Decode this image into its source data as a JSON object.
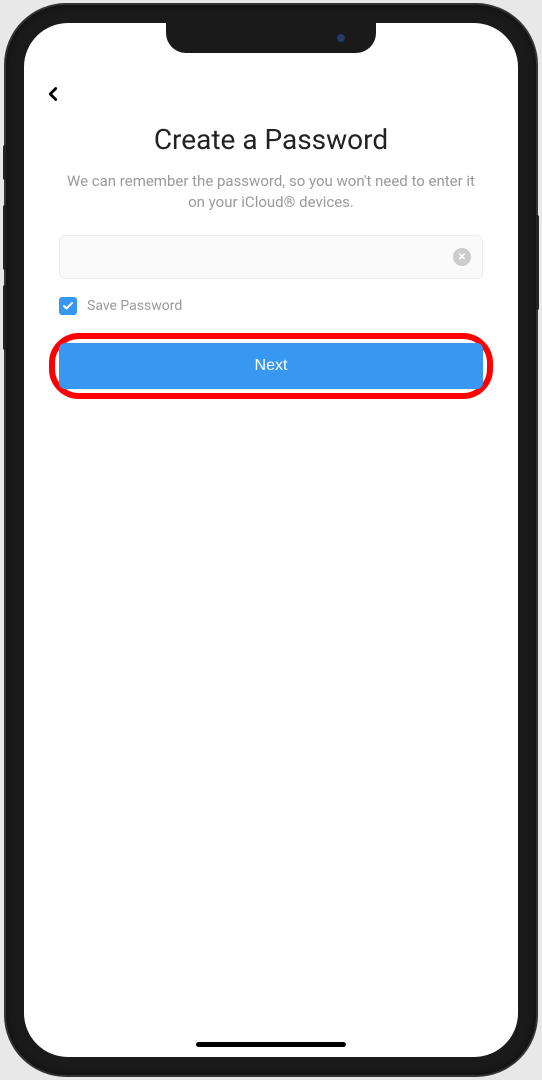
{
  "header": {
    "title": "Create a Password",
    "subtitle": "We can remember the password, so you won't need to enter it on your iCloud® devices."
  },
  "form": {
    "password_value": "",
    "password_placeholder": "",
    "save_password_label": "Save Password",
    "save_password_checked": true,
    "next_button_label": "Next"
  }
}
